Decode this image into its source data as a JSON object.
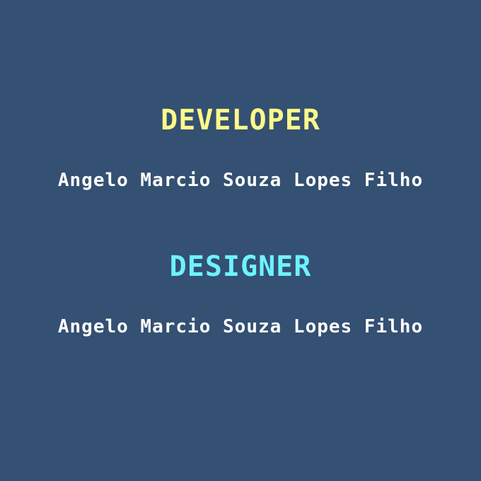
{
  "theme": {
    "background": "#345072",
    "name_color": "#ffffff"
  },
  "credits": [
    {
      "role": "DEVELOPER",
      "role_color": "#fff88a",
      "name": "Angelo Marcio Souza Lopes Filho"
    },
    {
      "role": "DESIGNER",
      "role_color": "#6ef2ff",
      "name": "Angelo Marcio Souza Lopes Filho"
    }
  ]
}
